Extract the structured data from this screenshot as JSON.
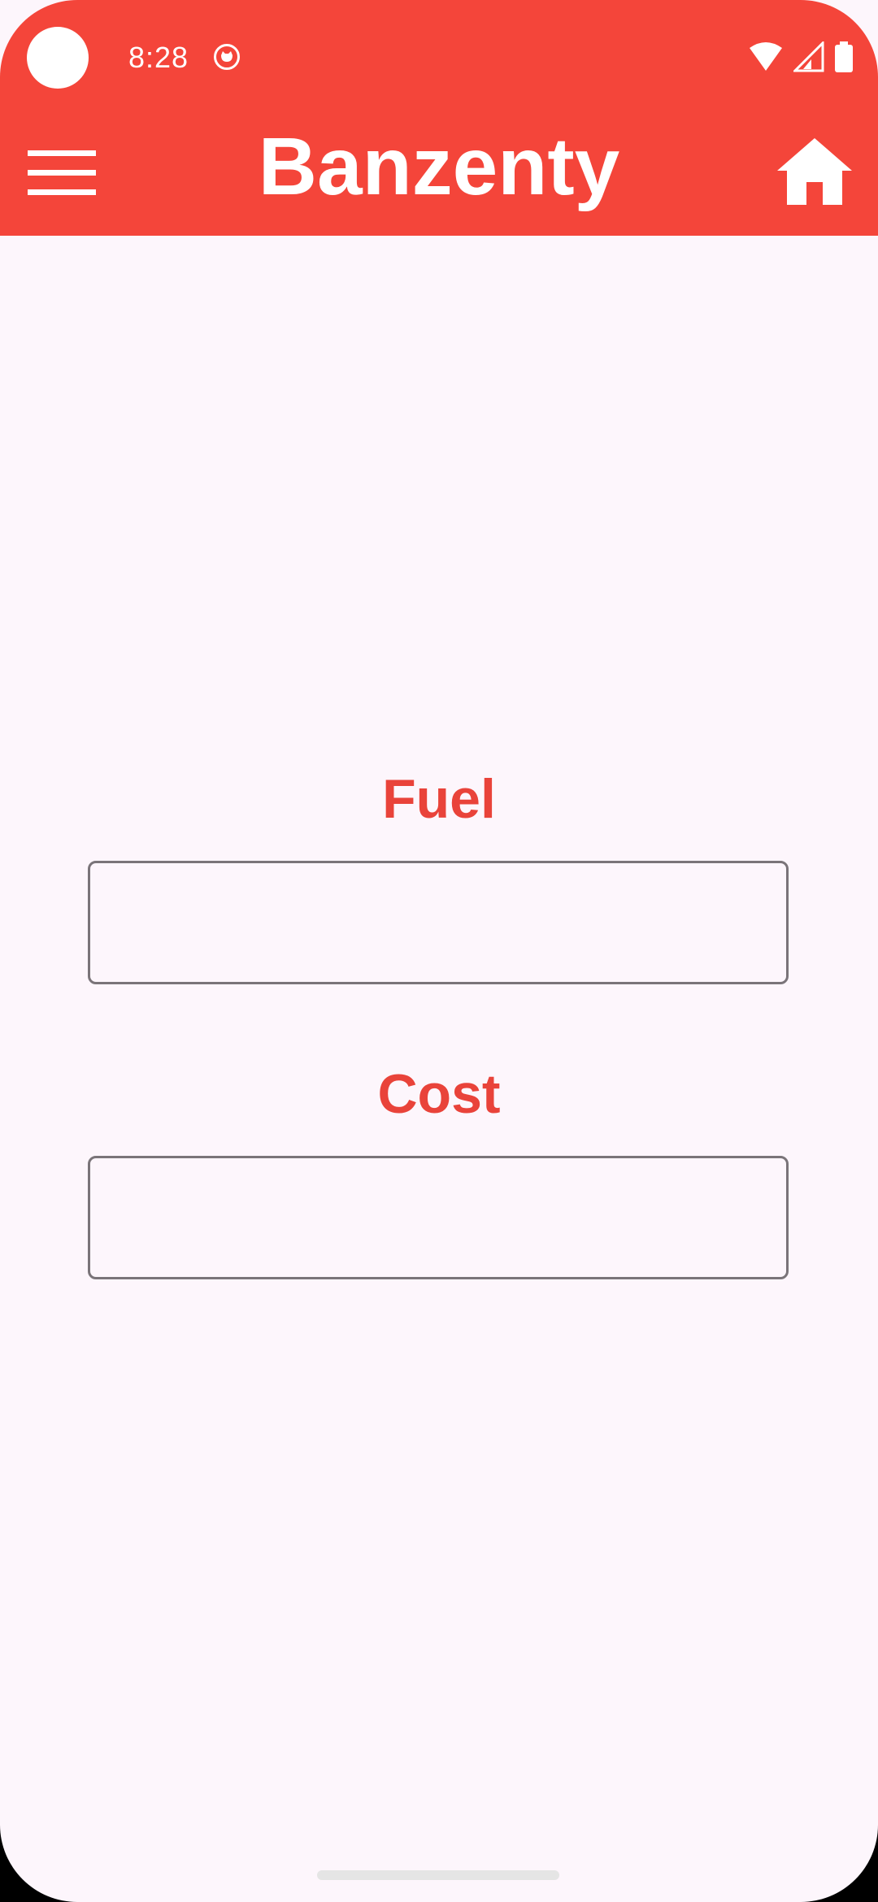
{
  "status_bar": {
    "time": "8:28",
    "icons": [
      "camera-cutout",
      "notification-icon",
      "wifi-icon",
      "signal-icon",
      "battery-icon"
    ]
  },
  "app_bar": {
    "title": "Banzenty",
    "left_icon": "menu-icon",
    "right_icon": "home-icon"
  },
  "form": {
    "fuel": {
      "label": "Fuel",
      "value": "",
      "placeholder": ""
    },
    "cost": {
      "label": "Cost",
      "value": "",
      "placeholder": ""
    }
  },
  "colors": {
    "primary": "#f4453a",
    "label": "#e9433a",
    "background": "#fdf6fc",
    "field_border": "#7a7479"
  }
}
